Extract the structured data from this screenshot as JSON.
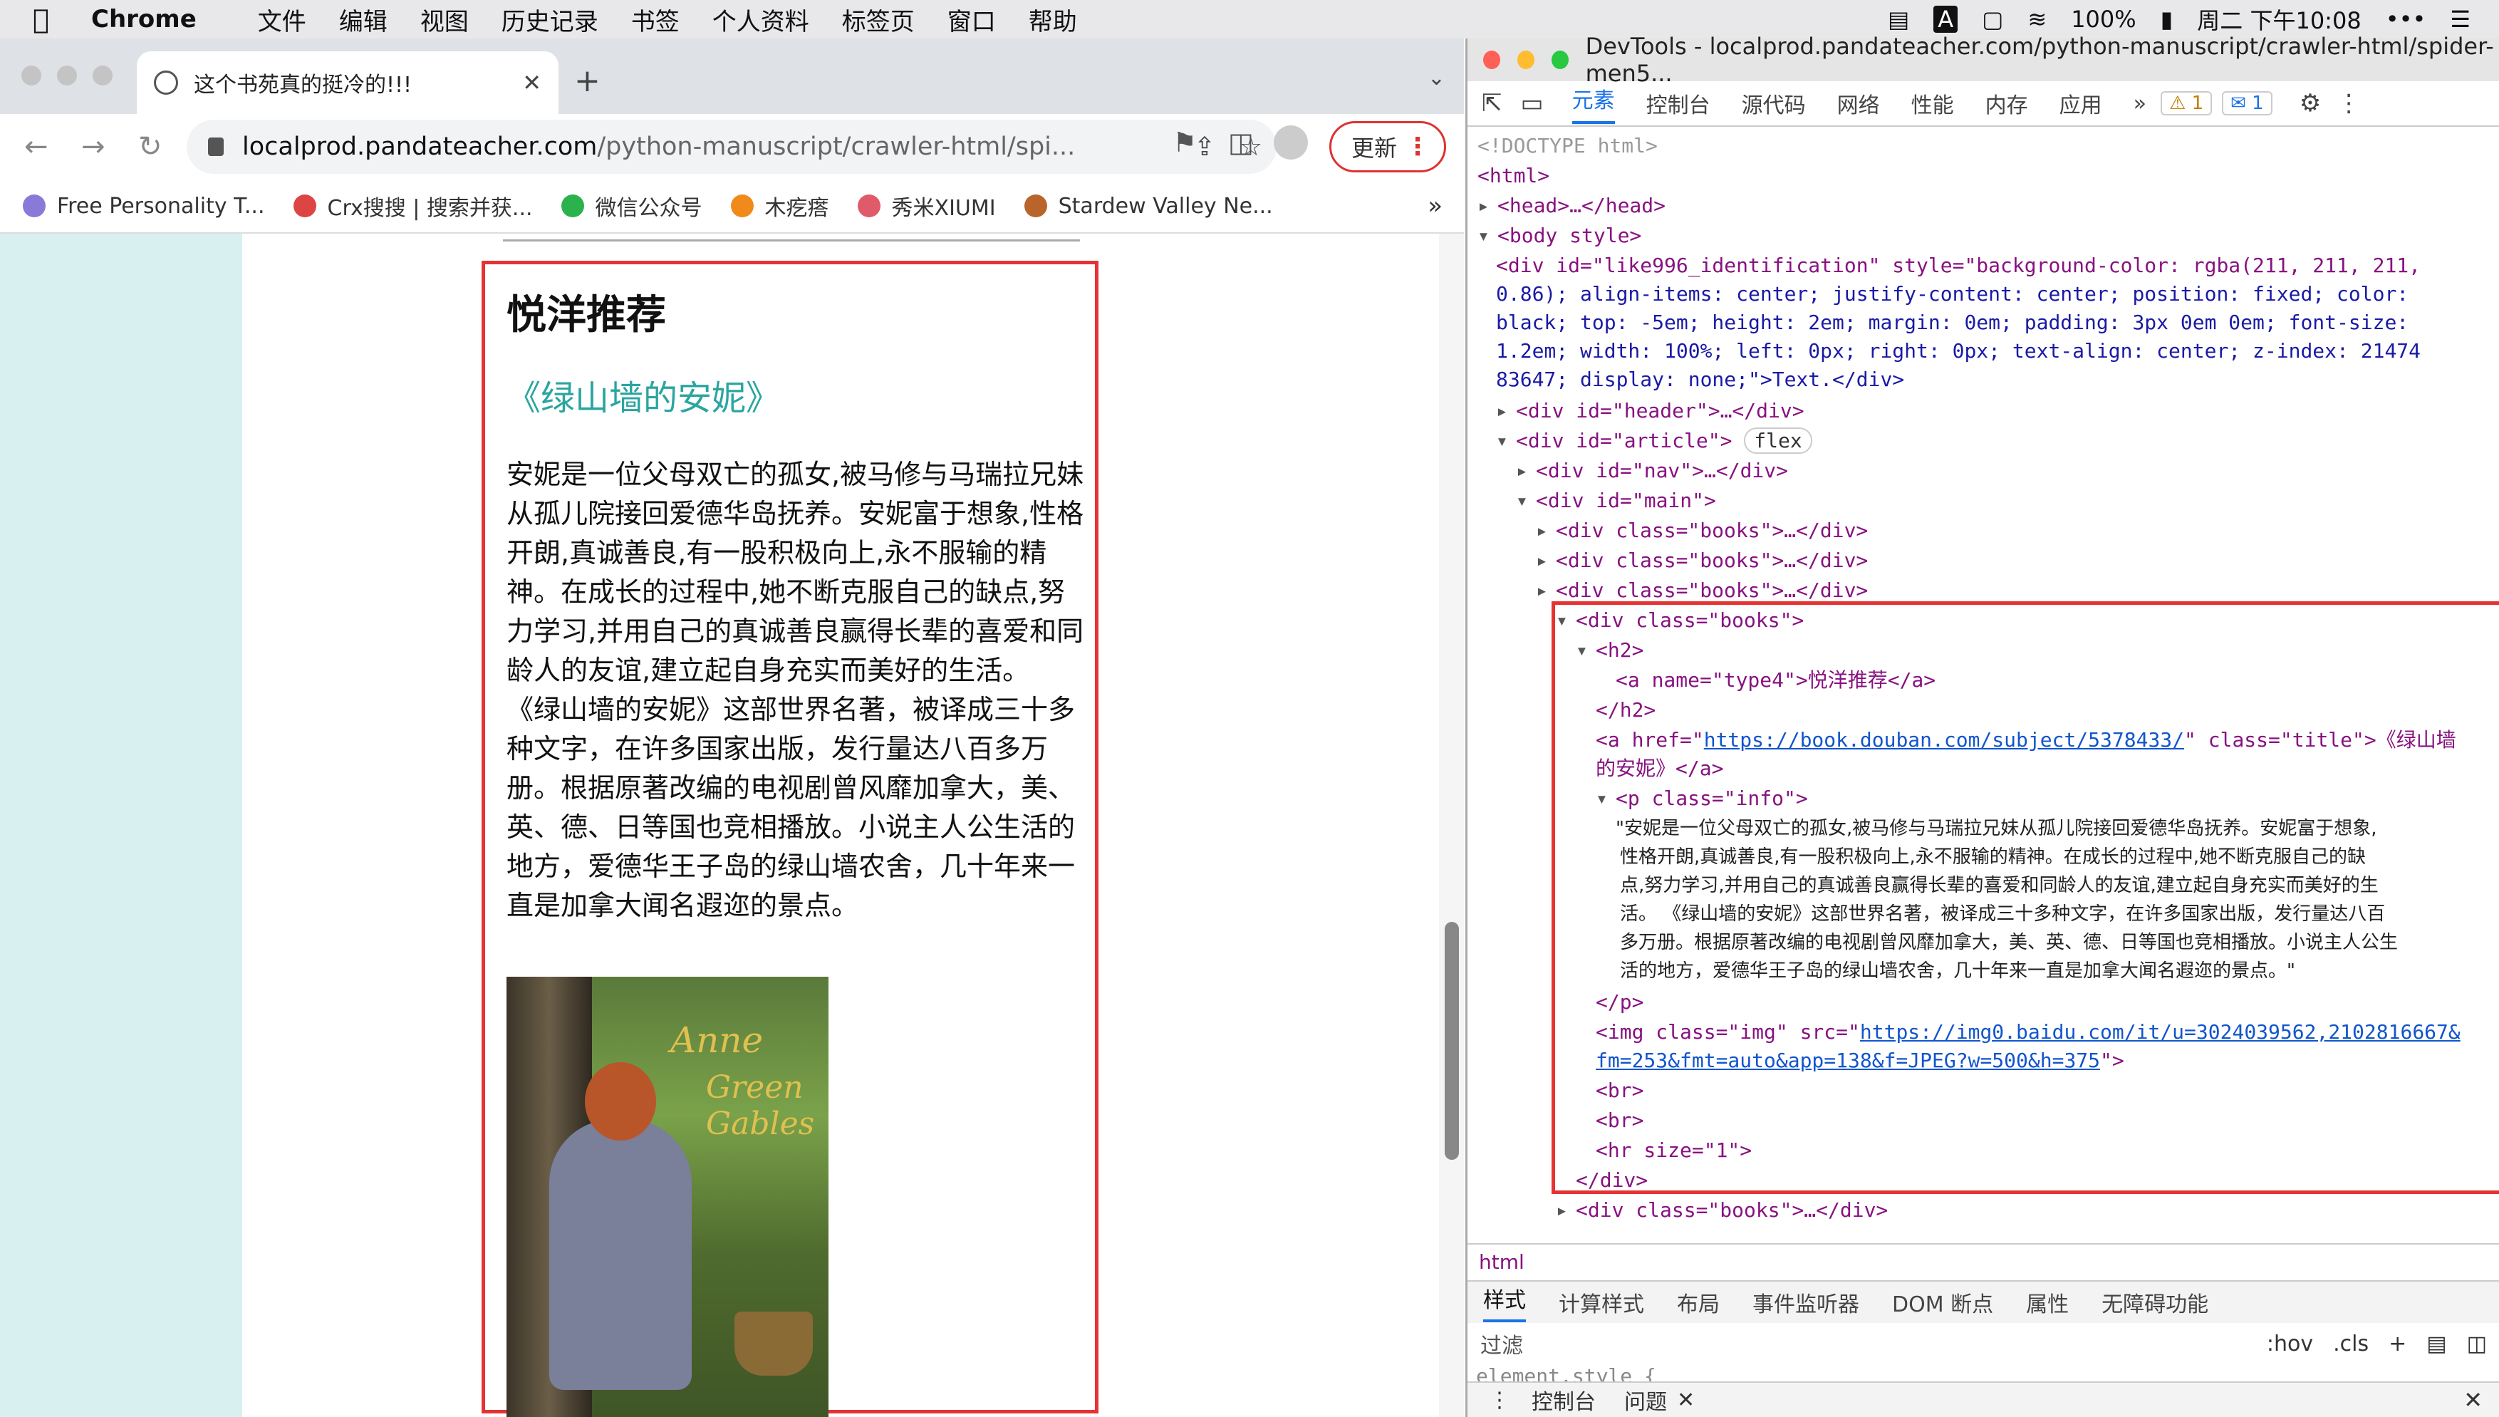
{
  "menubar": {
    "app": "Chrome",
    "items": [
      "文件",
      "编辑",
      "视图",
      "历史记录",
      "书签",
      "个人资料",
      "标签页",
      "窗口",
      "帮助"
    ],
    "battery": "100%",
    "clock": "周二 下午10:08"
  },
  "browser": {
    "tab_title": "这个书苑真的挺冷的!!!",
    "url_host": "localprod.pandateacher.com",
    "url_path": "/python-manuscript/crawler-html/spi...",
    "update_label": "更新",
    "bookmarks": [
      {
        "label": "Free Personality T...",
        "color": "#8a7ad8"
      },
      {
        "label": "Crx搜搜 | 搜索并获...",
        "color": "#d44"
      },
      {
        "label": "微信公众号",
        "color": "#2bb24c"
      },
      {
        "label": "木疙瘩",
        "color": "#f08a1a"
      },
      {
        "label": "秀米XIUMI",
        "color": "#e05a6a"
      },
      {
        "label": "Stardew Valley Ne...",
        "color": "#b8642a"
      }
    ],
    "more": "»"
  },
  "content": {
    "heading": "悦洋推荐",
    "book_title": "《绿山墙的安妮》",
    "info": "安妮是一位父母双亡的孤女,被马修与马瑞拉兄妹从孤儿院接回爱德华岛抚养。安妮富于想象,性格开朗,真诚善良,有一股积极向上,永不服输的精神。在成长的过程中,她不断克服自己的缺点,努力学习,并用自己的真诚善良赢得长辈的喜爱和同龄人的友谊,建立起自身充实而美好的生活。 《绿山墙的安妮》这部世界名著，被译成三十多种文字，在许多国家出版，发行量达八百多万册。根据原著改编的电视剧曾风靡加拿大，美、英、德、日等国也竞相播放。小说主人公生活的地方，爱德华王子岛的绿山墙农舍，几十年来一直是加拿大闻名遐迩的景点。",
    "cover_text_1": "Anne",
    "cover_text_2": "Green Gables"
  },
  "devtools": {
    "window_title": "DevTools - localprod.pandateacher.com/python-manuscript/crawler-html/spider-men5...",
    "tabs": [
      "元素",
      "控制台",
      "源代码",
      "网络",
      "性能",
      "内存",
      "应用"
    ],
    "warn_count": "1",
    "msg_count": "1",
    "breadcrumb": "html",
    "style_tabs": [
      "样式",
      "计算样式",
      "布局",
      "事件监听器",
      "DOM 断点",
      "属性",
      "无障碍功能"
    ],
    "filter_placeholder": "过滤",
    "hov": ":hov",
    "cls": ".cls",
    "element_style": "element.style {",
    "drawer_items": [
      "控制台",
      "问题"
    ],
    "tree": {
      "doctype": "<!DOCTYPE html>",
      "html_open": "<html>",
      "head": "<head>…</head>",
      "body_open": "<body style>",
      "like996_line1": "<div id=\"like996_identification\" style=\"background-color: rgba(211, 211, 211,",
      "like996_line2": "0.86); align-items: center; justify-content: center; position: fixed; color:",
      "like996_line3": "black; top: -5em; height: 2em; margin: 0em; padding: 3px 0em 0em; font-size:",
      "like996_line4": "1.2em; width: 100%; left: 0px; right: 0px; text-align: center; z-index: 21474",
      "like996_line5": "83647; display: none;\">Text.</div>",
      "header": "<div id=\"header\">…</div>",
      "article": "<div id=\"article\">",
      "flex_badge": "flex",
      "nav": "<div id=\"nav\">…</div>",
      "main": "<div id=\"main\">",
      "books_collapsed": "<div class=\"books\">…</div>",
      "books_open": "<div class=\"books\">",
      "h2_open": "<h2>",
      "a_type4": "<a name=\"type4\">悦洋推荐</a>",
      "h2_close": "</h2>",
      "a_href_pre": "<a href=\"",
      "a_href_url": "https://book.douban.com/subject/5378433/",
      "a_href_post": "\" class=\"title\">《绿山墙",
      "a_href_line2": "的安妮》</a>",
      "p_open": "<p class=\"info\">",
      "p_text_1": "\"安妮是一位父母双亡的孤女,被马修与马瑞拉兄妹从孤儿院接回爱德华岛抚养。安妮富于想象,",
      "p_text_2": "性格开朗,真诚善良,有一股积极向上,永不服输的精神。在成长的过程中,她不断克服自己的缺",
      "p_text_3": "点,努力学习,并用自己的真诚善良赢得长辈的喜爱和同龄人的友谊,建立起自身充实而美好的生",
      "p_text_4": "活。 《绿山墙的安妮》这部世界名著，被译成三十多种文字，在许多国家出版，发行量达八百",
      "p_text_5": "多万册。根据原著改编的电视剧曾风靡加拿大，美、英、德、日等国也竞相播放。小说主人公生",
      "p_text_6": "活的地方，爱德华王子岛的绿山墙农舍，几十年来一直是加拿大闻名遐迩的景点。\"",
      "p_close": "</p>",
      "img_pre": "<img class=\"img\" src=\"",
      "img_url_1": "https://img0.baidu.com/it/u=3024039562,2102816667&",
      "img_url_2": "fm=253&fmt=auto&app=138&f=JPEG?w=500&h=375",
      "img_post": "\">",
      "br": "<br>",
      "hr": "<hr size=\"1\">",
      "div_close": "</div>",
      "books_last": "<div class=\"books\">…</div>"
    }
  }
}
